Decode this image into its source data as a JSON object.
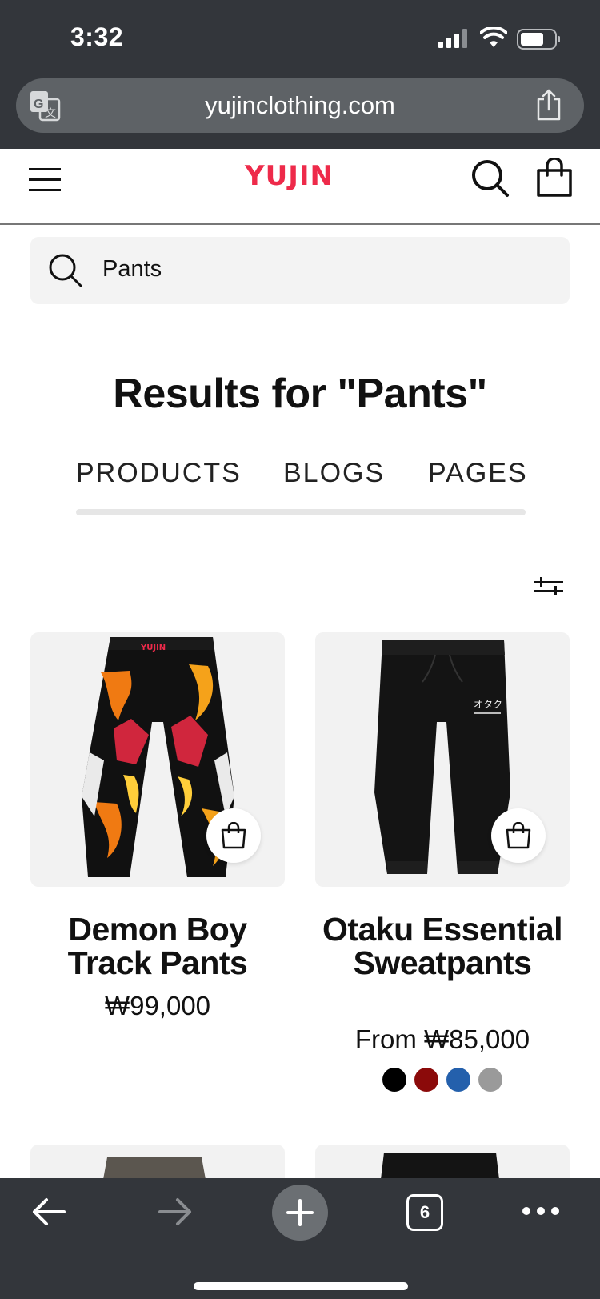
{
  "status": {
    "time": "3:32"
  },
  "browser": {
    "url": "yujinclothing.com",
    "open_tabs": "6",
    "icons": [
      "translate-icon",
      "share-icon",
      "back-arrow-icon",
      "forward-arrow-icon",
      "plus-icon",
      "tabs-icon",
      "more-icon"
    ]
  },
  "site": {
    "logo": "YUJIN",
    "brand_color": "#ee2a4a",
    "icons": [
      "menu-icon",
      "search-icon",
      "cart-bag-icon"
    ]
  },
  "search": {
    "value": "Pants"
  },
  "results": {
    "title": "Results for \"Pants\"",
    "tabs": [
      "PRODUCTS",
      "BLOGS",
      "PAGES"
    ]
  },
  "products": [
    {
      "title": "Demon Boy Track Pants",
      "price": "₩99,000"
    },
    {
      "title": "Otaku Essential Sweatpants",
      "price": "From ₩85,000",
      "swatches": [
        "#000000",
        "#8b0a0a",
        "#2460ac",
        "#9a9a9a"
      ]
    }
  ]
}
